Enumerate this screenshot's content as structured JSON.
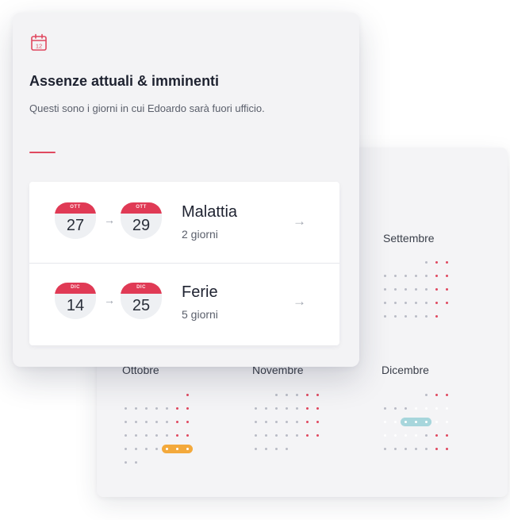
{
  "colors": {
    "accent": "#e0485f",
    "cap": "#e03a55",
    "orange": "#f3a93c",
    "teal_dark": "#1a8f9c",
    "teal_light": "#a7d6dc"
  },
  "absence_card": {
    "icon": "calendar-icon",
    "icon_day": "12",
    "title": "Assenze attuali & imminenti",
    "subtitle": "Questi sono i giorni in cui Edoardo sarà fuori ufficio.",
    "items": [
      {
        "from_month": "OTT",
        "from_day": "27",
        "to_month": "OTT",
        "to_day": "29",
        "type": "Malattia",
        "duration": "2 giorni",
        "arrow_icon": "arrow-right-icon"
      },
      {
        "from_month": "DIC",
        "from_day": "14",
        "to_month": "DIC",
        "to_day": "25",
        "type": "Ferie",
        "duration": "5 giorni",
        "arrow_icon": "arrow-right-icon"
      }
    ]
  },
  "calendar": {
    "months": [
      "Settembre",
      "Ottobre",
      "Novembre",
      "Dicembre"
    ]
  }
}
